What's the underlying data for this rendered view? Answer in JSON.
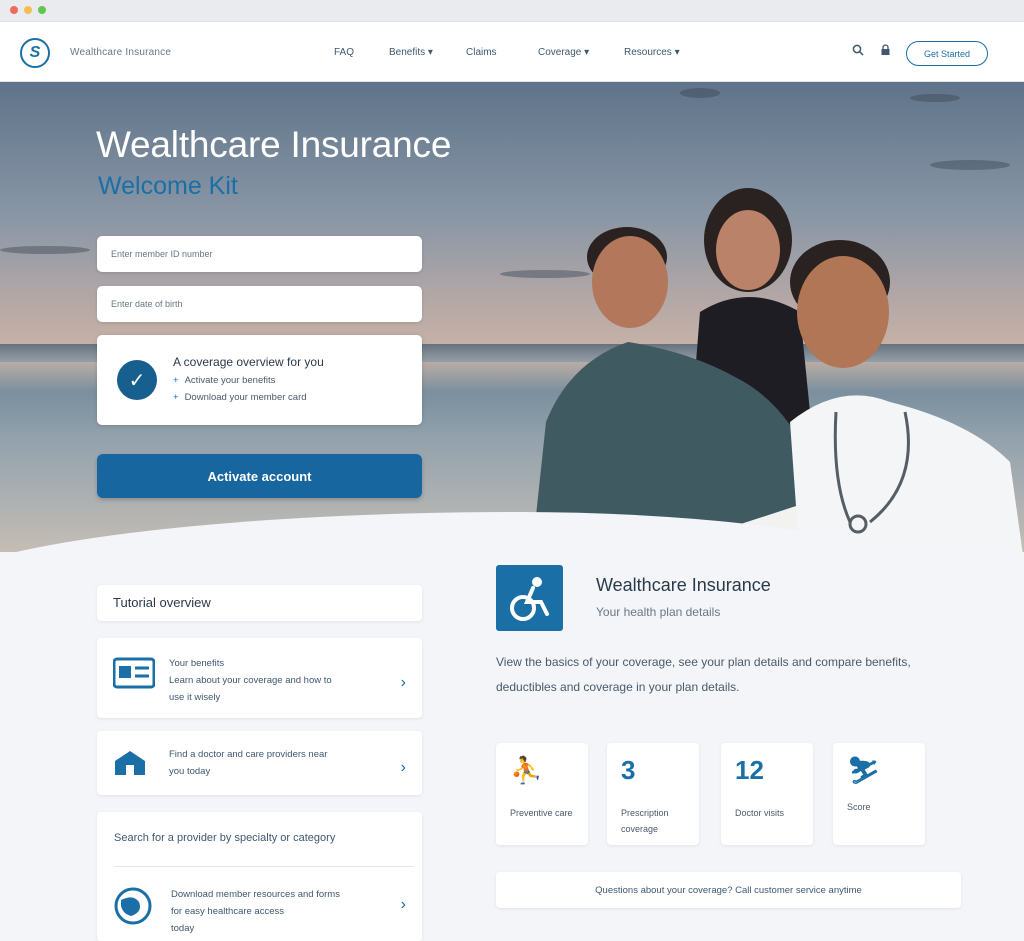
{
  "nav": {
    "brand": "Wealthcare Insurance",
    "items": [
      "FAQ",
      "Benefits ▾",
      "Claims",
      "Coverage ▾",
      "Resources ▾"
    ],
    "cta": "Get Started"
  },
  "hero": {
    "title": "Wealthcare Insurance",
    "subtitle": "Welcome Kit",
    "field1": "Enter member ID number",
    "field2": "Enter date of birth",
    "checklist_title": "A coverage overview for you",
    "checklist_items": [
      "Activate your benefits",
      "Download your member card"
    ],
    "button": "Activate account"
  },
  "left": {
    "section_title": "Tutorial overview",
    "cards": [
      {
        "icon": "▤",
        "line1": "Your benefits",
        "line2": "Learn about your coverage and how to",
        "line3": "use it wisely"
      },
      {
        "icon": "☗",
        "line1": "Find a doctor and care providers near",
        "line2": "you today",
        "line3": ""
      },
      {
        "icon": "☺",
        "line1": "Download member resources and forms",
        "line2": "for easy healthcare access",
        "line3": "today"
      }
    ],
    "plain_text": "Search for a provider by specialty or category"
  },
  "plan": {
    "title": "Wealthcare Insurance",
    "subtitle": "Your health plan details",
    "description": "View the basics of your coverage, see your plan details and compare benefits, deductibles and coverage in your plan details."
  },
  "tiles": [
    {
      "icon": "⛹",
      "label": "Preventive care"
    },
    {
      "icon": "3",
      "label": "Prescription coverage"
    },
    {
      "icon": "12",
      "label": "Doctor visits"
    },
    {
      "icon": "⛷",
      "label": "Score"
    }
  ],
  "bottom_bar": "Questions about your coverage? Call customer service anytime",
  "colors": {
    "primary": "#1766a0",
    "accent": "#1a6fa6",
    "background": "#f3f5f8"
  }
}
